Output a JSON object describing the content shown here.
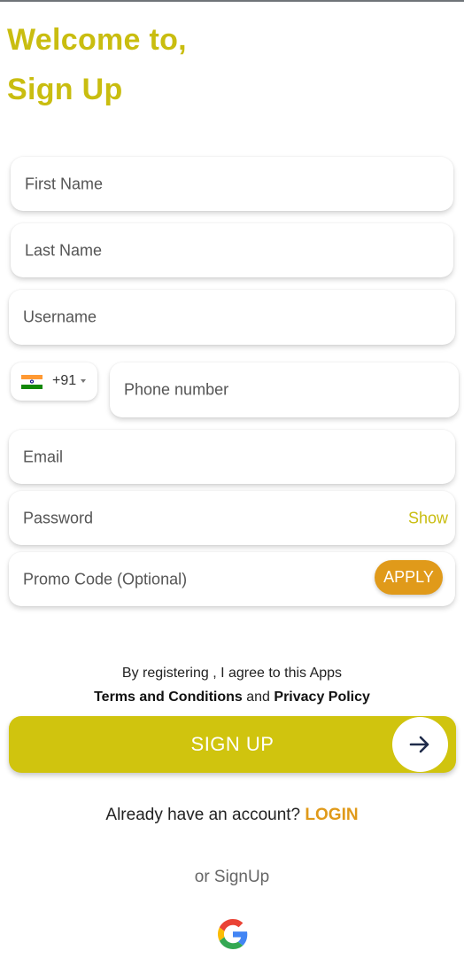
{
  "header": {
    "line1": "Welcome to,",
    "line2": "Sign Up"
  },
  "form": {
    "first_name_placeholder": "First Name",
    "last_name_placeholder": "Last Name",
    "username_placeholder": "Username",
    "country_code": "+91",
    "country_flag_icon": "india-flag-icon",
    "phone_placeholder": "Phone number",
    "email_placeholder": "Email",
    "password_placeholder": "Password",
    "show_label": "Show",
    "promo_placeholder": "Promo Code (Optional)",
    "apply_label": "APPLY"
  },
  "terms": {
    "line1": "By registering , I agree to this Apps",
    "terms_link": "Terms and Conditions",
    "and_text": "and",
    "privacy_link": "Privacy Policy"
  },
  "signup_button": {
    "label": "SIGN UP",
    "icon": "arrow-right-icon"
  },
  "login_prompt": {
    "text": "Already have an account?",
    "link": "LOGIN"
  },
  "social": {
    "label": "or SignUp",
    "icon": "google-icon"
  },
  "colors": {
    "accent": "#c9bd10",
    "button": "#d0c40e",
    "orange": "#e09a1a"
  }
}
